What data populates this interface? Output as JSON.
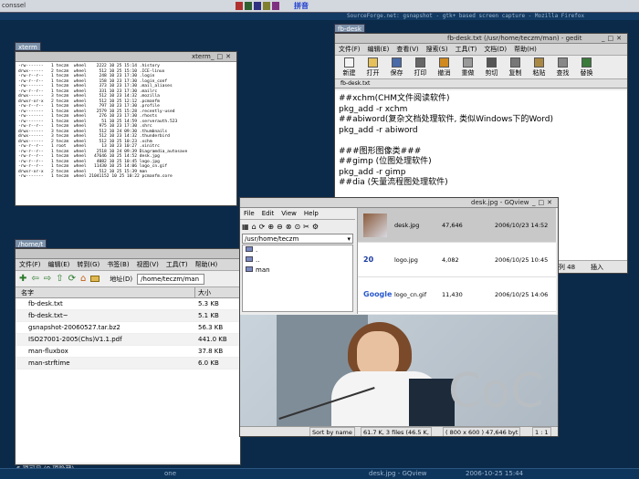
{
  "top_panel": {
    "left_label": "conssel",
    "tray": "拼音",
    "active_title": "SourceForge.net: gsnapshot - gtk+ based screen capture - Mozilla Firefox"
  },
  "terminal": {
    "tab_label": "xterm",
    "title": "xterm",
    "lines": [
      "-rw-------   1 teczm  wheel    2222 10 25 15:14 .history",
      "drwx------   2 teczm  wheel     512 10 25 15:10 .ICE-linux",
      "-rw-r--r--   1 teczm  wheel     248 10 23 17:30 .login",
      "-rw-r--r--   1 teczm  wheel     158 10 23 17:30 .login_conf",
      "-rw-------   1 teczm  wheel     373 10 23 17:30 .mail_aliases",
      "-rw-r--r--   1 teczm  wheel     331 10 23 17:30 .mailrc",
      "drwx------   3 teczm  wheel     512 10 23 14:32 .mozilla",
      "drwxr-xr-x   2 teczm  wheel     512 10 25 12:12 .pcmanfm",
      "-rw-r--r--   1 teczm  wheel     797 10 23 17:30 .profile",
      "-rw-------   1 teczm  wheel    2579 10 25 15:28 .recently-used",
      "-rw-------   1 teczm  wheel     276 10 23 17:30 .rhosts",
      "-rw-------   1 teczm  wheel      51 10 25 14:59 .serverauth.523",
      "-rw-r--r--   1 teczm  wheel     975 10 23 17:30 .shrc",
      "drwx------   3 teczm  wheel     512 10 24 09:30 .thumbnails",
      "drwx------   3 teczm  wheel     512 10 23 14:32 .thunderbird",
      "drwx------   2 teczm  wheel     512 10 25 10:23 .xchm",
      "-rw-r--r--   1 root   wheel      13 10 23 10:27 .xinitrc",
      "-rw-r--r--   1 teczm  wheel    2518 10 24 09:39 Diagramdia_autosave",
      "-rw-r--r--   1 teczm  wheel   47646 10 25 14:52 desk.jpg",
      "-rw-r--r--   1 teczm  wheel    4082 10 25 10:45 logo.jpg",
      "-rw-r--r--   1 teczm  wheel   11430 10 25 14:06 logo_cn.gif",
      "drwxr-xr-x   2 teczm  wheel     512 10 25 15:39 man",
      "-rw-------   1 teczm  wheel 21041152 10 25 10:22 pcmanfm.core"
    ]
  },
  "gedit": {
    "tab_label": "fb-desk",
    "title": "fb-desk.txt (/usr/home/teczm/man) - gedit",
    "menu": [
      "文件(F)",
      "编辑(E)",
      "查看(V)",
      "搜索(S)",
      "工具(T)",
      "文档(D)",
      "帮助(H)"
    ],
    "toolbar": [
      "新建",
      "打开",
      "保存",
      "打印",
      "撤消",
      "重做",
      "剪切",
      "复制",
      "粘贴",
      "查找",
      "替换"
    ],
    "doc_tab": "fb-desk.txt",
    "lines": [
      "##xchm(CHM文件阅读软件)",
      "pkg_add -r xchm",
      "##abiword(复杂文档处理软件, 类似Windows下的Word)",
      "pkg_add -r abiword",
      "",
      "###图形图像类###",
      "##gimp (位图处理软件)",
      "pkg_add -r gimp",
      "##dia (矢量流程图处理软件)"
    ],
    "status_pos": "2, 列 48",
    "status_mode": "插入"
  },
  "file_manager": {
    "tab_label": "/home/t",
    "menu": [
      "文件(F)",
      "编辑(E)",
      "转到(G)",
      "书签(B)",
      "视图(V)",
      "工具(T)",
      "帮助(H)"
    ],
    "address_label": "地址(D)",
    "address": "/home/teczm/man",
    "columns": [
      "名字",
      "大小"
    ],
    "files": [
      {
        "name": "fb-desk.txt",
        "size": "5.3 KB"
      },
      {
        "name": "fb-desk.txt~",
        "size": "5.1 KB"
      },
      {
        "name": "gsnapshot-20060527.tar.bz2",
        "size": "56.3 KB"
      },
      {
        "name": "ISO27001-2005(Chs)V1.1.pdf",
        "size": "441.0 KB"
      },
      {
        "name": "man-fluxbox",
        "size": "37.8 KB"
      },
      {
        "name": "man-strftime",
        "size": "6.0 KB"
      }
    ],
    "status": "6 项可见 (0 项隐藏)"
  },
  "gqview": {
    "title": "desk.jpg - GQview",
    "menu": [
      "File",
      "Edit",
      "View",
      "Help"
    ],
    "path": "/usr/home/teczm",
    "tree": [
      ".",
      "..",
      "man"
    ],
    "thumbs": [
      {
        "name": "desk.jpg",
        "size": "47,646",
        "date": "2006/10/23 14:52"
      },
      {
        "name": "logo.jpg",
        "size": "4,082",
        "date": "2006/10/25 10:45"
      },
      {
        "name": "logo_cn.gif",
        "size": "11,430",
        "date": "2006/10/25 14:06"
      }
    ],
    "logo_label": "20",
    "google_label": "Google",
    "image_text": "CoC",
    "status": [
      "Sort by name",
      "61.7 K, 3 files (46.5 K,",
      "( 800 x 600 ) 47,646 byt",
      "1 : 1"
    ]
  },
  "bottom_panel": {
    "desktop": "one",
    "task": "desk.jpg - GQview",
    "clock": "2006-10-25 15:44"
  },
  "colors": {
    "desktop": "#0b2a4a",
    "title_bar": "#c6c6c6",
    "selection": "#c8c8c8"
  }
}
